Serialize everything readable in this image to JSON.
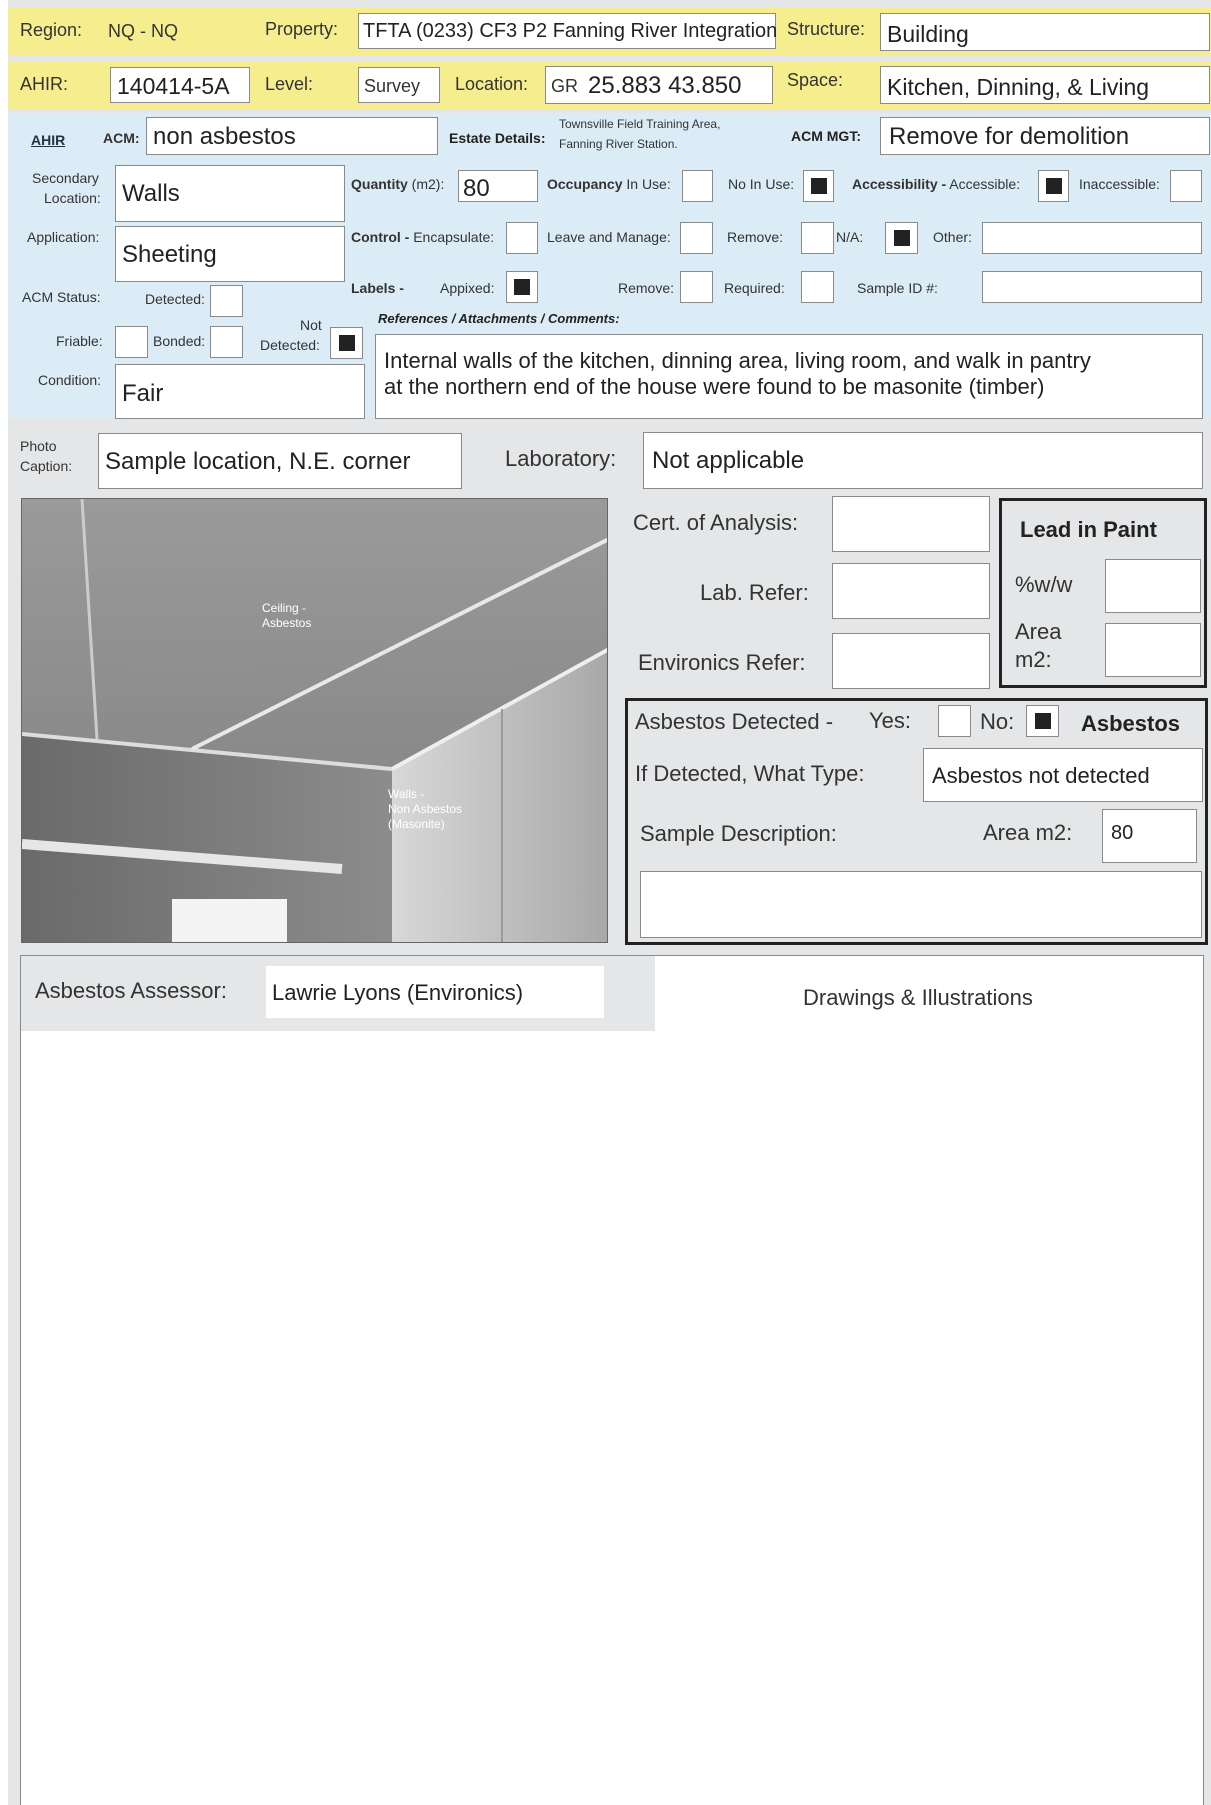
{
  "header": {
    "region_label": "Region:",
    "region_value": "NQ - NQ",
    "property_label": "Property:",
    "property_value": "TFTA (0233) CF3 P2 Fanning River Integration",
    "structure_label": "Structure:",
    "structure_value": "Building",
    "ahir_label": "AHIR:",
    "ahir_value": "140414-5A",
    "level_label": "Level:",
    "level_value": "Survey",
    "location_label": "Location:",
    "location_prefix": "GR",
    "location_value": "25.883  43.850",
    "space_label": "Space:",
    "space_value": "Kitchen, Dinning, & Living"
  },
  "acm_row": {
    "ahir_link": "AHIR",
    "acm_label": "ACM:",
    "acm_value": "non asbestos",
    "estate_label": "Estate Details:",
    "estate_line1": "Townsville Field Training Area,",
    "estate_line2": "Fanning River Station.",
    "mgt_label": "ACM MGT:",
    "mgt_value": "Remove for demolition"
  },
  "details": {
    "secondary_label_1": "Secondary",
    "secondary_label_2": "Location:",
    "secondary_value": "Walls",
    "quantity_label": "Quantity",
    "quantity_unit": "(m2):",
    "quantity_value": "80",
    "occupancy_label": "Occupancy",
    "in_use_label": "In Use:",
    "no_in_use_label": "No In Use:",
    "accessibility_label": "Accessibility -",
    "accessible_label": "Accessible:",
    "inaccessible_label": "Inaccessible:",
    "application_label": "Application:",
    "application_value": "Sheeting",
    "control_label": "Control -",
    "encapsulate_label": "Encapsulate:",
    "leave_manage_label": "Leave and Manage:",
    "remove_label": "Remove:",
    "na_label": "N/A:",
    "other_label": "Other:",
    "labels_label": "Labels -",
    "appixed_label": "Appixed:",
    "labels_remove_label": "Remove:",
    "required_label": "Required:",
    "sample_id_label": "Sample ID #:",
    "acm_status_label": "ACM Status:",
    "detected_label": "Detected:",
    "friable_label": "Friable:",
    "bonded_label": "Bonded:",
    "not_label": "Not",
    "not_detected_label": "Detected:",
    "refs_label": "References / Attachments / Comments:",
    "condition_label": "Condition:",
    "condition_value": "Fair",
    "comment_line1": "Internal walls of the kitchen, dinning area, living room, and walk in pantry",
    "comment_line2": "at the northern end of the house were found to be masonite (timber)"
  },
  "photo_row": {
    "caption_label_1": "Photo",
    "caption_label_2": "Caption:",
    "caption_value": "Sample location, N.E. corner",
    "laboratory_label": "Laboratory:",
    "laboratory_value": "Not applicable"
  },
  "photo": {
    "ceiling_l1": "Ceiling -",
    "ceiling_l2": "Asbestos",
    "walls_l1": "Walls -",
    "walls_l2": "Non Asbestos",
    "walls_l3": "(Masonite)"
  },
  "analysis": {
    "cert_label": "Cert. of Analysis:",
    "lab_refer_label": "Lab. Refer:",
    "environics_refer_label": "Environics Refer:",
    "lead_title": "Lead in Paint",
    "ww_label": "%w/w",
    "area_label_1": "Area",
    "area_label_2": "m2:"
  },
  "asbestos": {
    "detected_label": "Asbestos Detected -",
    "yes_label": "Yes:",
    "no_label": "No:",
    "title": "Asbestos",
    "type_label": "If Detected, What Type:",
    "type_value": "Asbestos not detected",
    "sample_desc_label": "Sample Description:",
    "area_label": "Area m2:",
    "area_value": "80"
  },
  "assessor": {
    "label": "Asbestos Assessor:",
    "value": "Lawrie Lyons (Environics)",
    "drawings_label": "Drawings & Illustrations"
  },
  "checks": {
    "in_use": false,
    "no_in_use": true,
    "accessible": true,
    "inaccessible": false,
    "encapsulate": false,
    "leave_manage": false,
    "remove": false,
    "na": true,
    "appixed": true,
    "labels_remove": false,
    "required": false,
    "detected": false,
    "friable": false,
    "bonded": false,
    "not_detected": true,
    "asbestos_yes": false,
    "asbestos_no": true
  }
}
